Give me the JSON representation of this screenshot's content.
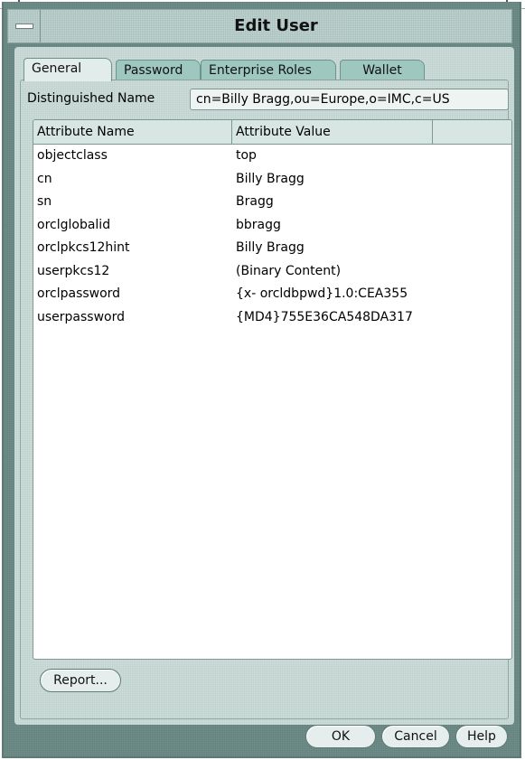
{
  "window": {
    "title": "Edit User"
  },
  "tabs": [
    {
      "label": "General",
      "active": true
    },
    {
      "label": "Password",
      "active": false
    },
    {
      "label": "Enterprise Roles",
      "active": false
    },
    {
      "label": "Wallet",
      "active": false
    }
  ],
  "dn": {
    "label": "Distinguished Name",
    "value": "cn=Billy Bragg,ou=Europe,o=IMC,c=US"
  },
  "table": {
    "columns": [
      "Attribute Name",
      "Attribute Value"
    ],
    "rows": [
      [
        "objectclass",
        "top"
      ],
      [
        "cn",
        "Billy Bragg"
      ],
      [
        "sn",
        "Bragg"
      ],
      [
        "orclglobalid",
        "bbragg"
      ],
      [
        "orclpkcs12hint",
        "Billy Bragg"
      ],
      [
        "userpkcs12",
        "(Binary Content)"
      ],
      [
        "orclpassword",
        "{x- orcldbpwd}1.0:CEA355"
      ],
      [
        "userpassword",
        "{MD4}755E36CA548DA317"
      ]
    ]
  },
  "buttons": {
    "report": "Report...",
    "ok": "OK",
    "cancel": "Cancel",
    "help": "Help"
  },
  "colors": {
    "frame": "#6f8f8b",
    "titlebar": "#bfd6d2",
    "panel": "#cfe0dc",
    "tab": "#9dc7bf"
  }
}
